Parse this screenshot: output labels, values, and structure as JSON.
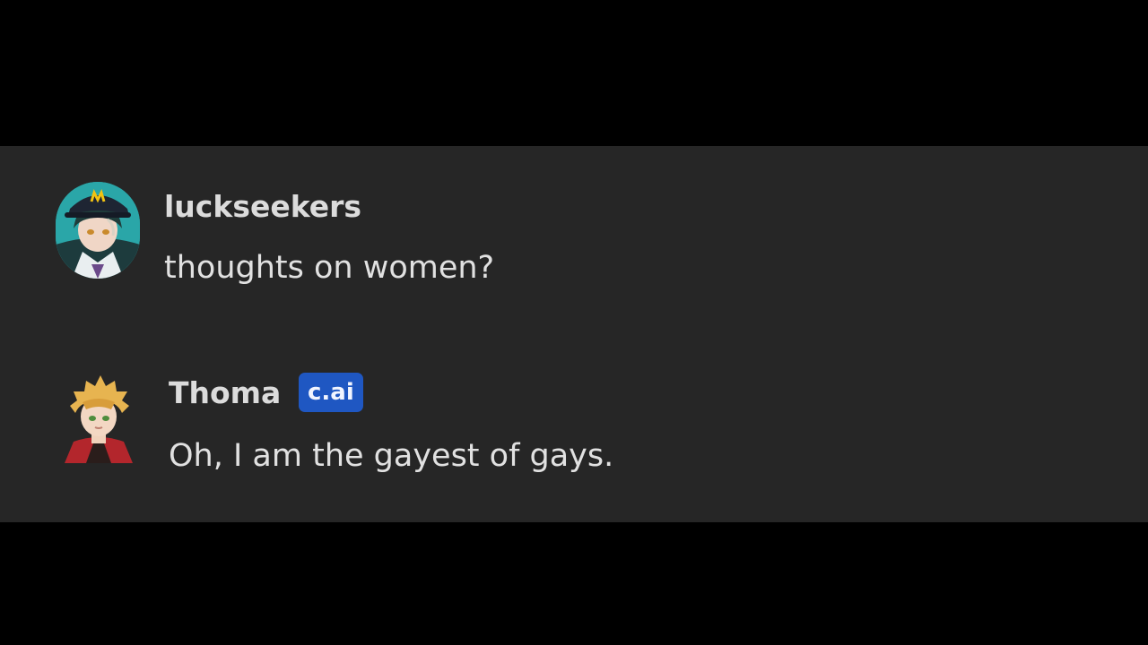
{
  "colors": {
    "letterbox": "#000000",
    "panel": "#262626",
    "author_text": "#dcdcdc",
    "message_text": "#e1e1e1",
    "badge_bg": "#1f57c2",
    "badge_text": "#f2f5ff"
  },
  "messages": [
    {
      "author": "luckseekers",
      "avatar_icon": "user-avatar-icon",
      "text": "thoughts on women?"
    },
    {
      "author": "Thoma",
      "badge": "c.ai",
      "avatar_icon": "character-avatar-icon",
      "text": "Oh, I am the gayest of gays."
    }
  ]
}
